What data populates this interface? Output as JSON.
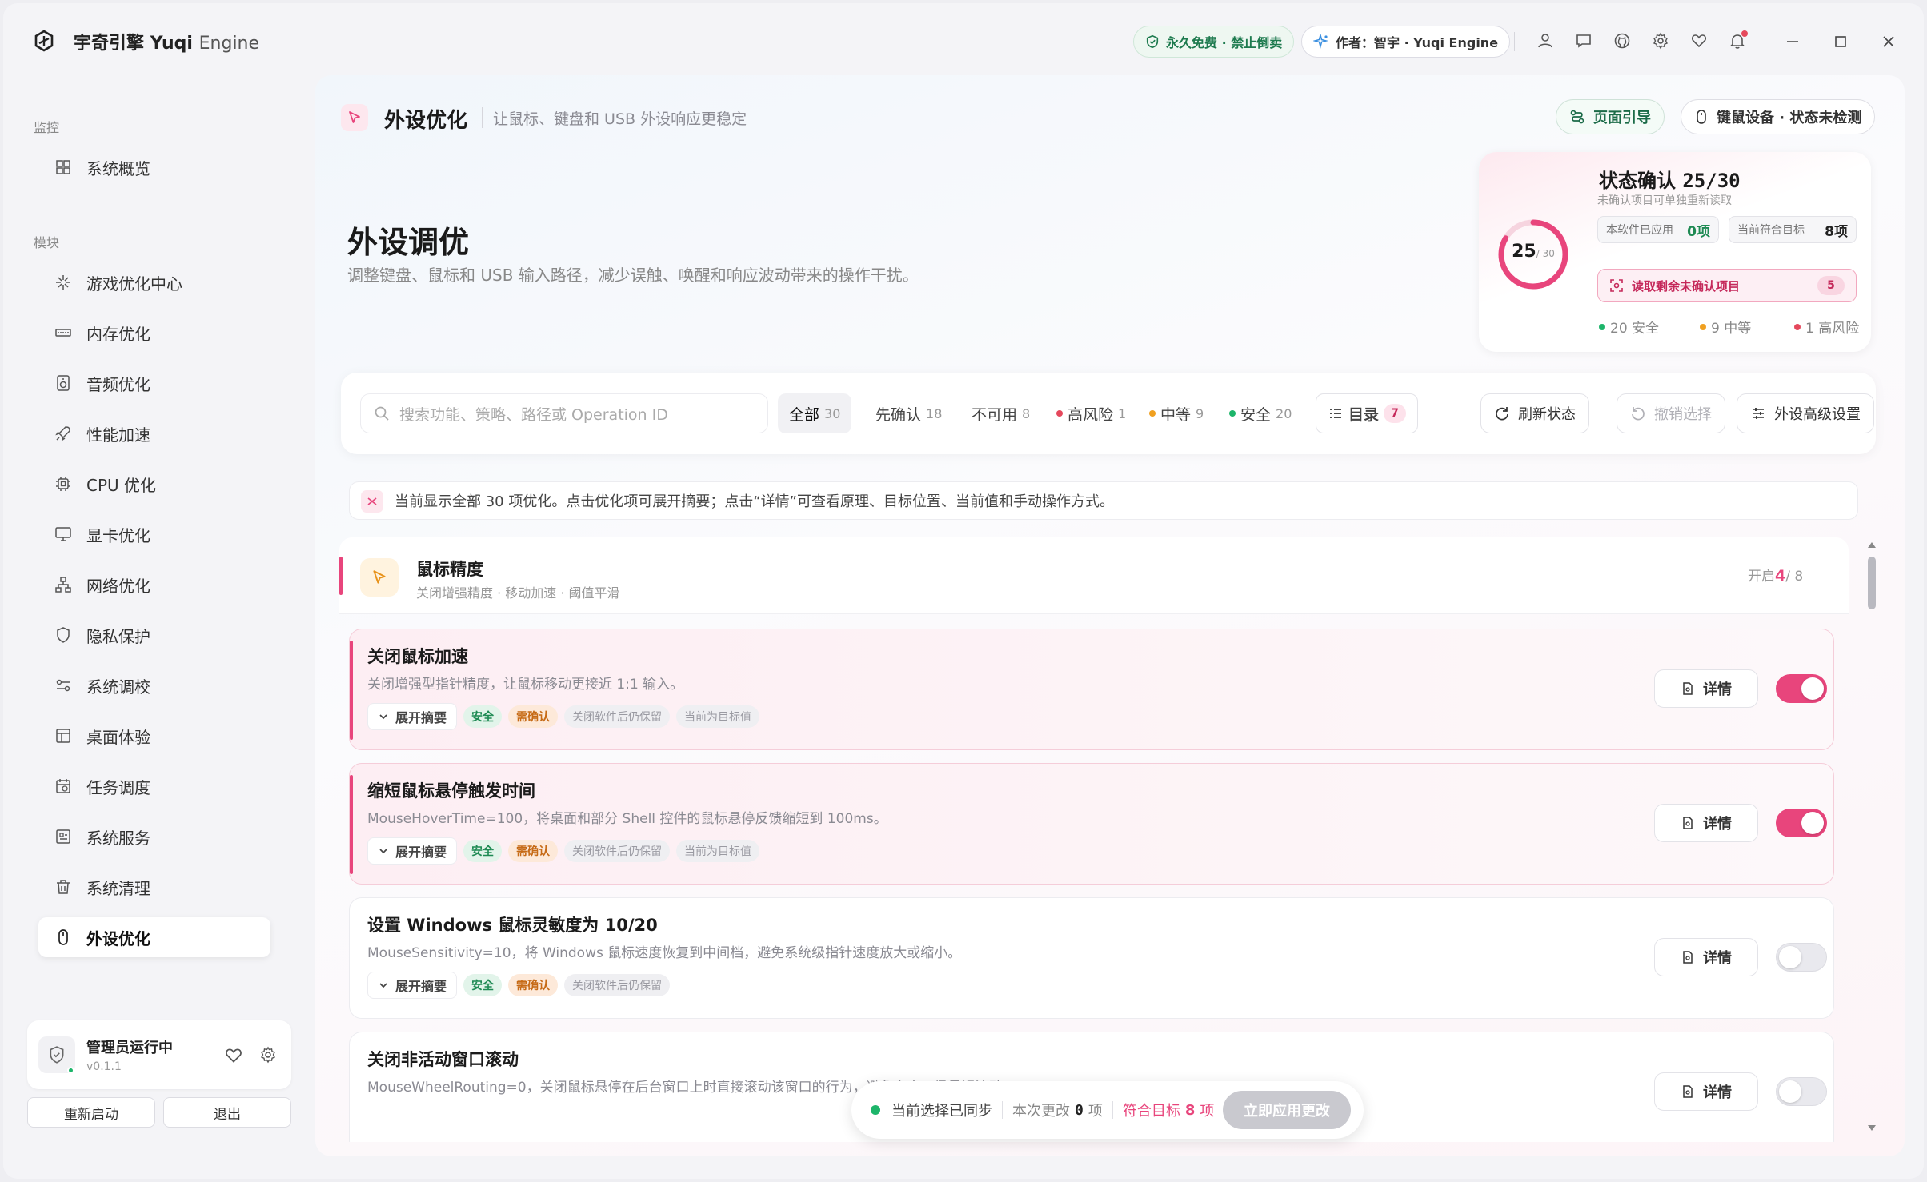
{
  "app": {
    "name": "宇奇引擎",
    "name_en": "Yuqi",
    "name_en2": "Engine",
    "badge_free": "永久免费 · 禁止倒卖",
    "badge_author": "作者：智宇 · Yuqi Engine"
  },
  "sidebar": {
    "group_monitor": "监控",
    "group_modules": "模块",
    "items": [
      {
        "label": "系统概览",
        "icon": "dashboard-icon"
      },
      {
        "label": "游戏优化中心",
        "icon": "gamepad-icon"
      },
      {
        "label": "内存优化",
        "icon": "memory-icon"
      },
      {
        "label": "音频优化",
        "icon": "speaker-icon"
      },
      {
        "label": "性能加速",
        "icon": "rocket-icon"
      },
      {
        "label": "CPU 优化",
        "icon": "cpu-icon"
      },
      {
        "label": "显卡优化",
        "icon": "monitor-icon"
      },
      {
        "label": "网络优化",
        "icon": "network-icon"
      },
      {
        "label": "隐私保护",
        "icon": "shield-icon"
      },
      {
        "label": "系统调校",
        "icon": "sliders-icon"
      },
      {
        "label": "桌面体验",
        "icon": "layout-icon"
      },
      {
        "label": "任务调度",
        "icon": "calendar-icon"
      },
      {
        "label": "系统服务",
        "icon": "services-icon"
      },
      {
        "label": "系统清理",
        "icon": "trash-icon"
      },
      {
        "label": "外设优化",
        "icon": "mouse-icon",
        "active": true
      }
    ],
    "admin_title": "管理员运行中",
    "admin_version": "v0.1.1",
    "restart_label": "重新启动",
    "exit_label": "退出"
  },
  "header": {
    "title": "外设优化",
    "subtitle": "让鼠标、键盘和 USB 外设响应更稳定",
    "guide_label": "页面引导",
    "kb_label": "键鼠设备 · 状态未检测"
  },
  "hero": {
    "title": "外设调优",
    "subtitle": "调整键盘、鼠标和 USB 输入路径，减少误触、唤醒和响应波动带来的操作干扰。"
  },
  "status": {
    "title": "状态确认",
    "value": "25/30",
    "confirmed": 25,
    "total": 30,
    "ring_num": "25",
    "ring_total": "/ 30",
    "subtitle": "未确认项目可单独重新读取",
    "applied_label": "本软件已应用",
    "applied_value": "0项",
    "target_label": "当前符合目标",
    "target_value": "8项",
    "read_label": "读取剩余未确认项目",
    "read_count": "5",
    "safe_label": "20 安全",
    "medium_label": "9 中等",
    "high_label": "1 高风险",
    "colors": {
      "safe": "#1db56a",
      "medium": "#f0a020",
      "high": "#e5485c",
      "accent": "#e8457c"
    }
  },
  "toolbar": {
    "search_placeholder": "搜索功能、策略、路径或 Operation ID",
    "filters": [
      {
        "label": "全部",
        "count": "30"
      },
      {
        "label": "先确认",
        "count": "18"
      },
      {
        "label": "不可用",
        "count": "8"
      },
      {
        "label": "高风险",
        "count": "1"
      },
      {
        "label": "中等",
        "count": "9"
      },
      {
        "label": "安全",
        "count": "20"
      }
    ],
    "toc_label": "目录",
    "toc_count": "7",
    "refresh_label": "刷新状态",
    "undo_label": "撤销选择",
    "advanced_label": "外设高级设置"
  },
  "notice": {
    "text": "当前显示全部 30 项优化。点击优化项可展开摘要；点击“详情”可查看原理、目标位置、当前值和手动操作方式。"
  },
  "section": {
    "title": "鼠标精度",
    "subtitle": "关闭增强精度 · 移动加速 · 阈值平滑",
    "count_prefix": "开启",
    "count_on": "4",
    "count_suffix": "/ 8"
  },
  "items": [
    {
      "title": "关闭鼠标加速",
      "desc": "关闭增强型指针精度，让鼠标移动更接近 1:1 输入。",
      "expand": "展开摘要",
      "tag_safe": "安全",
      "tag_confirm": "需确认",
      "tag_keep": "关闭软件后仍保留",
      "tag_target": "当前为目标值",
      "detail": "详情",
      "on": true
    },
    {
      "title": "缩短鼠标悬停触发时间",
      "desc": "MouseHoverTime=100，将桌面和部分 Shell 控件的鼠标悬停反馈缩短到 100ms。",
      "expand": "展开摘要",
      "tag_safe": "安全",
      "tag_confirm": "需确认",
      "tag_keep": "关闭软件后仍保留",
      "tag_target": "当前为目标值",
      "detail": "详情",
      "on": true
    },
    {
      "title": "设置 Windows 鼠标灵敏度为 10/20",
      "desc": "MouseSensitivity=10，将 Windows 鼠标速度恢复到中间档，避免系统级指针速度放大或缩小。",
      "expand": "展开摘要",
      "tag_safe": "安全",
      "tag_confirm": "需确认",
      "tag_keep": "关闭软件后仍保留",
      "detail": "详情",
      "on": false
    },
    {
      "title": "关闭非活动窗口滚动",
      "desc": "MouseWheelRouting=0，关闭鼠标悬停在后台窗口上时直接滚动该窗口的行为，避免多窗口场景误滚动。",
      "detail": "详情",
      "on": false
    }
  ],
  "apply": {
    "sync_label": "当前选择已同步",
    "changes_label": "本次更改",
    "changes_value": "0",
    "changes_unit": "项",
    "target_label": "符合目标",
    "target_value": "8",
    "target_unit": "项",
    "apply_label": "立即应用更改"
  }
}
